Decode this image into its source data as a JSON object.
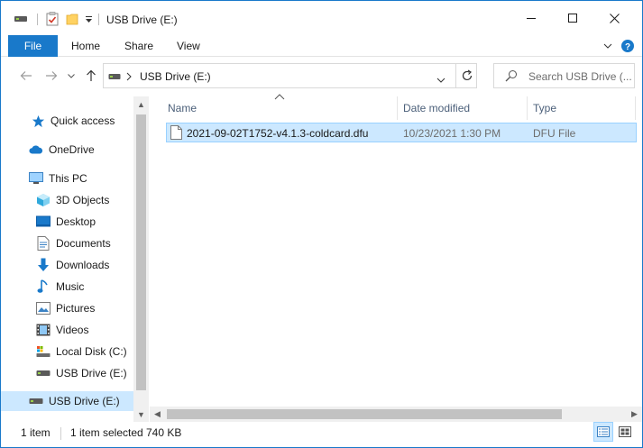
{
  "window": {
    "title": "USB Drive (E:)",
    "accent": "#1979ca"
  },
  "ribbon": {
    "file": "File",
    "home": "Home",
    "share": "Share",
    "view": "View"
  },
  "address": {
    "path": "USB Drive (E:)",
    "search_placeholder": "Search USB Drive (..."
  },
  "nav": {
    "quick_access": "Quick access",
    "onedrive": "OneDrive",
    "this_pc": "This PC",
    "objects3d": "3D Objects",
    "desktop": "Desktop",
    "documents": "Documents",
    "downloads": "Downloads",
    "music": "Music",
    "pictures": "Pictures",
    "videos": "Videos",
    "local_disk": "Local Disk (C:)",
    "usb_child": "USB Drive (E:)",
    "usb_root": "USB Drive (E:)"
  },
  "columns": {
    "name": "Name",
    "date": "Date modified",
    "type": "Type"
  },
  "files": [
    {
      "name": "2021-09-02T1752-v4.1.3-coldcard.dfu",
      "date": "10/23/2021 1:30 PM",
      "type": "DFU File"
    }
  ],
  "status": {
    "count": "1 item",
    "selected": "1 item selected",
    "size": "740 KB"
  },
  "icons": {
    "drive": "usb-drive-icon",
    "properties": "properties-icon",
    "folder": "new-folder-icon"
  }
}
